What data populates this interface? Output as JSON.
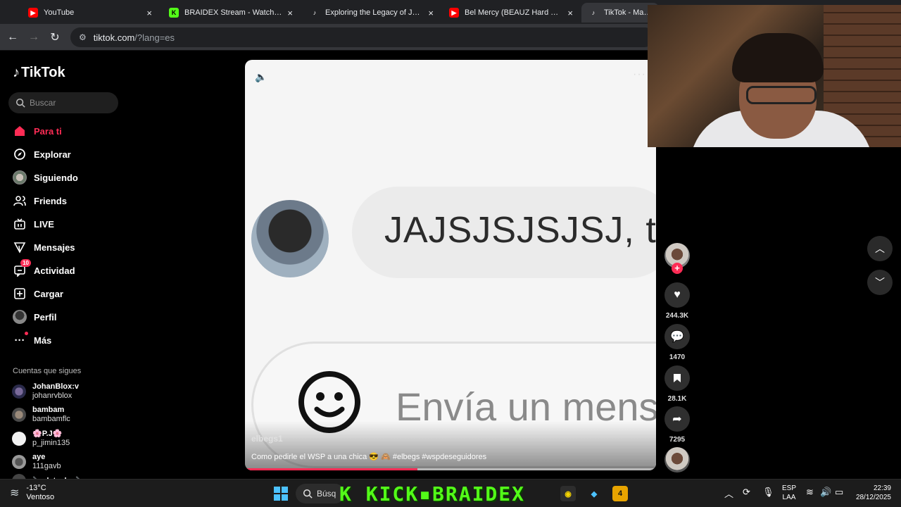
{
  "browser": {
    "tabs": [
      {
        "title": "YouTube",
        "icon": "youtube-icon",
        "active": false
      },
      {
        "title": "BRAIDEX Stream - Watch Live o",
        "icon": "kick-icon",
        "active": false
      },
      {
        "title": "Exploring the Legacy of José Jo",
        "icon": "tiktok-icon",
        "active": false
      },
      {
        "title": "Bel Mercy (BEAUZ Hard Techno",
        "icon": "youtube-icon",
        "active": false
      },
      {
        "title": "TikTok - Make Y",
        "icon": "tiktok-icon",
        "active": true
      }
    ],
    "close_glyph": "×",
    "url_host": "tiktok.com",
    "url_rest": "/?lang=es"
  },
  "sidebar": {
    "logo": "TikTok",
    "search_placeholder": "Buscar",
    "nav": [
      {
        "label": "Para ti",
        "icon": "home-icon",
        "active": true
      },
      {
        "label": "Explorar",
        "icon": "compass-icon"
      },
      {
        "label": "Siguiendo",
        "icon": "following-avatar-icon"
      },
      {
        "label": "Friends",
        "icon": "friends-icon"
      },
      {
        "label": "LIVE",
        "icon": "live-icon"
      },
      {
        "label": "Mensajes",
        "icon": "send-icon"
      },
      {
        "label": "Actividad",
        "icon": "activity-icon",
        "badge": "10"
      },
      {
        "label": "Cargar",
        "icon": "upload-icon"
      },
      {
        "label": "Perfil",
        "icon": "profile-avatar-icon"
      },
      {
        "label": "Más",
        "icon": "more-icon"
      }
    ],
    "following_title": "Cuentas que sigues",
    "following": [
      {
        "name": "JohanBlox:v",
        "handle": "johanrvblox"
      },
      {
        "name": "bambam",
        "handle": "bambamflc"
      },
      {
        "name": "🌸P.J🌸",
        "handle": "p_jimin135"
      },
      {
        "name": "aye",
        "handle": "111gavb"
      },
      {
        "name": "🔪 datzuko 🔪",
        "handle": ""
      }
    ]
  },
  "video": {
    "bubble_text": "JAJSJSJSJSJ, tu",
    "message_placeholder": "Envía un mens",
    "author": "elbegs1",
    "caption": "Como pedirle el WSP a una chica 😎 🙈 #elbegs #wspdeseguidores",
    "progress": 0.42,
    "more_glyph": "···"
  },
  "actions": {
    "likes": "244.3K",
    "comments": "1470",
    "saves": "28.1K",
    "shares": "7295"
  },
  "taskbar": {
    "temperature": "-13°C",
    "weather": "Ventoso",
    "search_label": "Búsq",
    "banner": "K KICK▪BRAIDEX",
    "lang_1": "ESP",
    "lang_2": "LAA",
    "time": "22:39",
    "date": "28/12/2025"
  },
  "colors": {
    "accent": "#fe2c55",
    "kick_green": "#53fc18"
  }
}
